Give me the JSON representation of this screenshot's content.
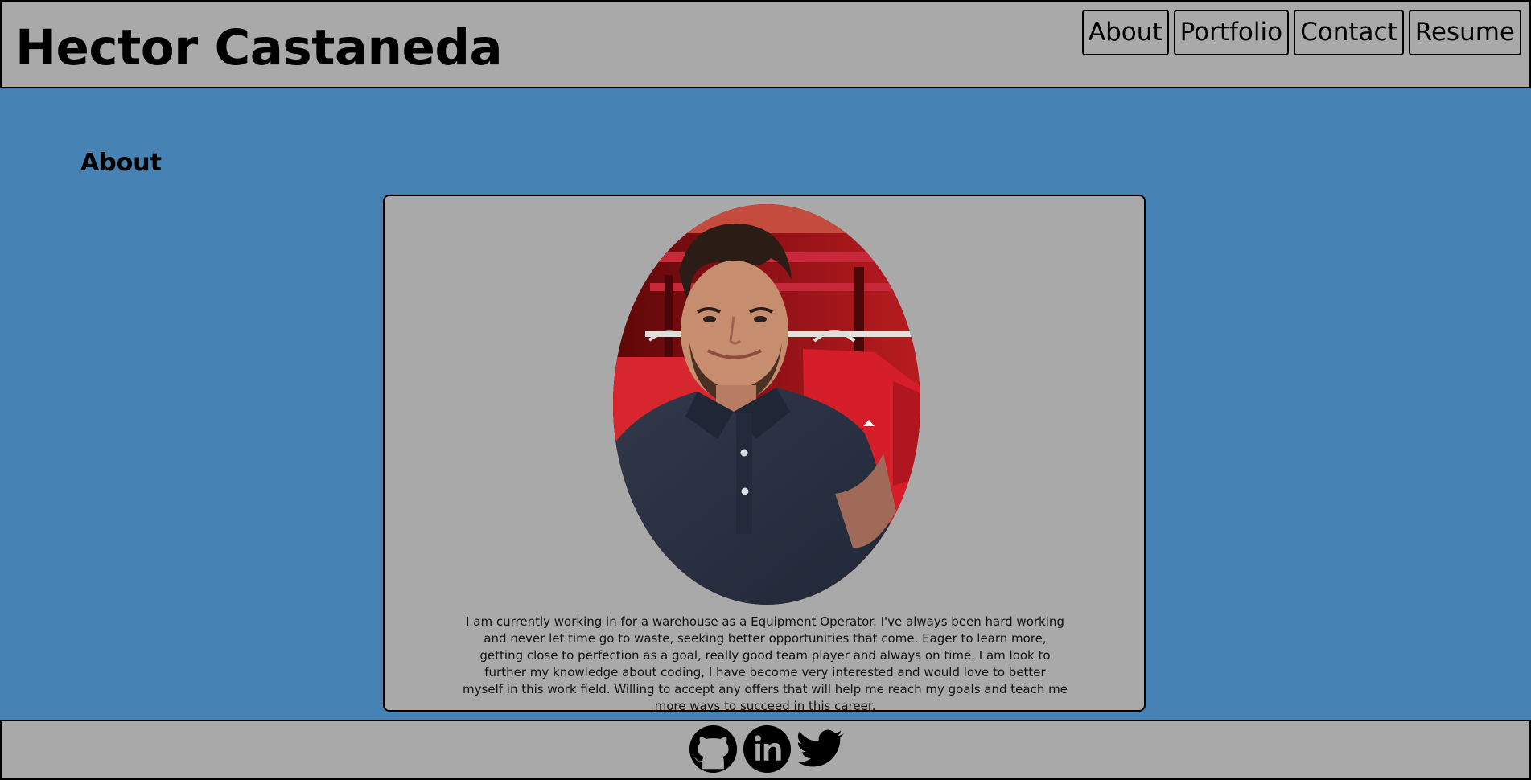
{
  "header": {
    "title": "Hector Castaneda",
    "nav": [
      {
        "label": "About"
      },
      {
        "label": "Portfolio"
      },
      {
        "label": "Contact"
      },
      {
        "label": "Resume"
      }
    ]
  },
  "about": {
    "heading": "About",
    "photo_alt": "",
    "description": "I am currently working in for a warehouse as a Equipment Operator. I've always been hard working and never let time go to waste, seeking better opportunities that come. Eager to learn more, getting close to perfection as a goal, really good team player and always on time. I am look to further my knowledge about coding, I have become very interested and would love to better myself in this work field. Willing to accept any offers that will help me reach my goals and teach me more ways to succeed in this career."
  },
  "footer": {
    "social_links": [
      {
        "icon": "github-icon"
      },
      {
        "icon": "linkedin-icon"
      },
      {
        "icon": "twitter-icon"
      }
    ]
  },
  "colors": {
    "page_background": "#4682b4",
    "panel_background": "#a9a9a9",
    "text": "#000000"
  }
}
